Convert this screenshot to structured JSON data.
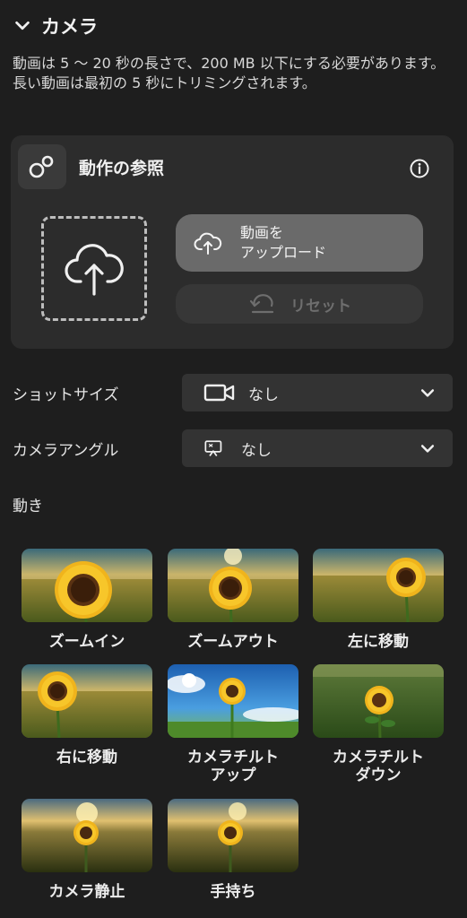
{
  "section": {
    "title": "カメラ"
  },
  "description": "動画は 5 〜 20 秒の長さで、200 MB 以下にする必要があります。長い動画は最初の 5 秒にトリミングされます。",
  "reference": {
    "title": "動作の参照",
    "upload_line1": "動画を",
    "upload_line2": "アップロード",
    "reset_label": "リセット"
  },
  "shot_size": {
    "label": "ショットサイズ",
    "value": "なし"
  },
  "camera_angle": {
    "label": "カメラアングル",
    "value": "なし"
  },
  "movement": {
    "label": "動き",
    "items": [
      {
        "line1": "ズームイン",
        "line2": ""
      },
      {
        "line1": "ズームアウト",
        "line2": ""
      },
      {
        "line1": "左に移動",
        "line2": ""
      },
      {
        "line1": "右に移動",
        "line2": ""
      },
      {
        "line1": "カメラチルト",
        "line2": "アップ"
      },
      {
        "line1": "カメラチルト",
        "line2": "ダウン"
      },
      {
        "line1": "カメラ静止",
        "line2": ""
      },
      {
        "line1": "手持ち",
        "line2": ""
      }
    ]
  },
  "colors": {
    "background": "#1e1e1e",
    "card": "#2c2c2c",
    "select": "#333333",
    "upload_button": "#6a6a6a",
    "reset_button": "#373737"
  }
}
